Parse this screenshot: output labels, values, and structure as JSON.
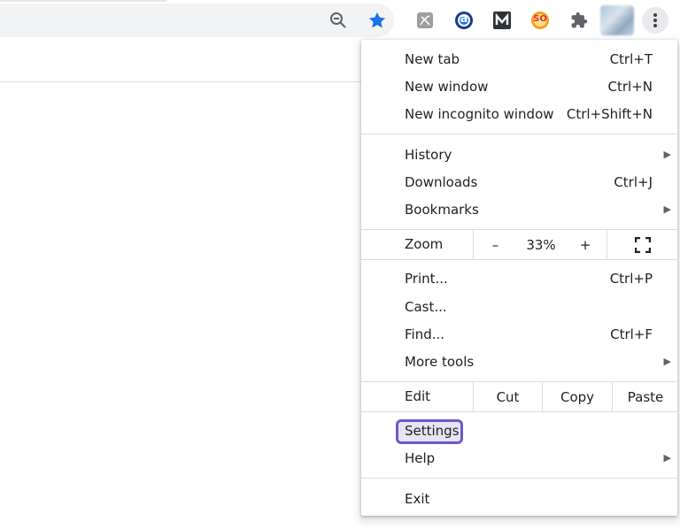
{
  "menu": {
    "items": [
      {
        "label": "New tab",
        "shortcut": "Ctrl+T"
      },
      {
        "label": "New window",
        "shortcut": "Ctrl+N"
      },
      {
        "label": "New incognito window",
        "shortcut": "Ctrl+Shift+N"
      },
      {
        "label": "History",
        "submenu": "▶"
      },
      {
        "label": "Downloads",
        "shortcut": "Ctrl+J"
      },
      {
        "label": "Bookmarks",
        "submenu": "▶"
      },
      {
        "label": "Print...",
        "shortcut": "Ctrl+P"
      },
      {
        "label": "Cast..."
      },
      {
        "label": "Find...",
        "shortcut": "Ctrl+F"
      },
      {
        "label": "More tools",
        "submenu": "▶"
      },
      {
        "label": "Settings"
      },
      {
        "label": "Help",
        "submenu": "▶"
      },
      {
        "label": "Exit"
      }
    ],
    "zoom": {
      "label": "Zoom",
      "minus": "–",
      "value": "33%",
      "plus": "+"
    },
    "edit": {
      "label": "Edit",
      "cut": "Cut",
      "copy": "Copy",
      "paste": "Paste"
    }
  },
  "toolbar": {
    "icons": [
      "zoom-out-icon",
      "star-icon",
      "pdf-extension-icon",
      "a-extension-icon",
      "m-extension-icon",
      "so-extension-icon",
      "puzzle-icon",
      "profile-avatar",
      "more-vert-icon"
    ],
    "so_label": "SO",
    "a_label": "a",
    "accent": "#1a73e8"
  },
  "colors": {
    "highlight_border": "#6a5acd",
    "highlight_fill": "#e8e4f6"
  }
}
